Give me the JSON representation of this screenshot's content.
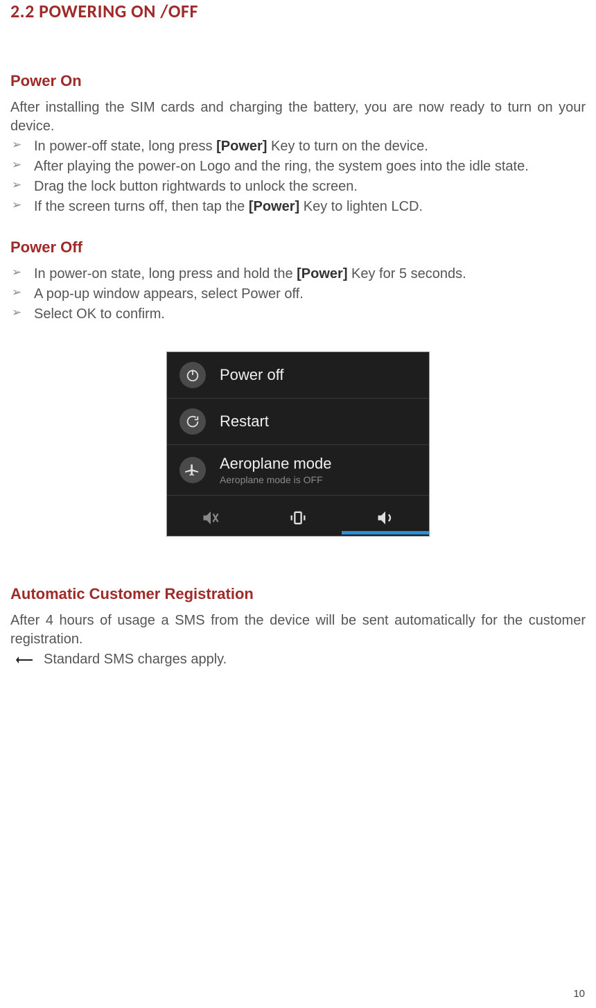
{
  "title": "2.2 POWERING ON /OFF",
  "powerOn": {
    "heading": "Power On",
    "intro": "After installing the SIM cards and charging the battery, you are now ready to turn on your device.",
    "items": {
      "0": {
        "pre": "In power-off state, long press ",
        "bold": "[Power]",
        "post": " Key to turn on the device."
      },
      "1": {
        "text": "After playing the power-on Logo and the ring, the system goes into the idle state."
      },
      "2": {
        "text": "Drag the lock button rightwards to unlock the screen."
      },
      "3": {
        "pre": "If the screen turns off, then tap the ",
        "bold": "[Power]",
        "post": " Key to lighten LCD."
      }
    }
  },
  "powerOff": {
    "heading": "Power Off",
    "items": {
      "0": {
        "pre": "In power-on state, long press and hold the ",
        "bold": "[Power]",
        "post": " Key for 5 seconds."
      },
      "1": {
        "text": "A pop-up window appears, select Power off."
      },
      "2": {
        "text": "Select OK to confirm."
      }
    }
  },
  "menu": {
    "powerOff": "Power off",
    "restart": "Restart",
    "aeroplane": "Aeroplane mode",
    "aeroplaneSub": "Aeroplane mode is OFF"
  },
  "acr": {
    "heading": "Automatic Customer Registration",
    "text": "After 4 hours of usage a SMS from the device will be sent automatically for the customer registration.",
    "note": "Standard SMS charges apply."
  },
  "pageNumber": "10"
}
